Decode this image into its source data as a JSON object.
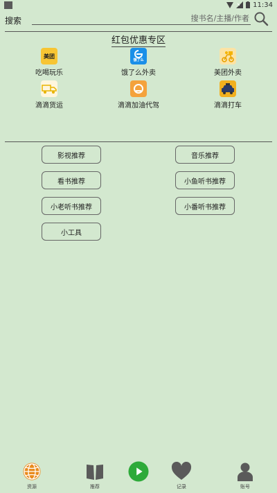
{
  "status": {
    "time": "11:34"
  },
  "search": {
    "label": "搜索",
    "placeholder": "搜书名/主播/作者"
  },
  "promo": {
    "title": "红包优惠专区",
    "items": [
      {
        "label": "吃喝玩乐",
        "logo_text": "美团",
        "icon": "meituan-logo-icon"
      },
      {
        "label": "饿了么外卖",
        "logo_text": "饿了么",
        "icon": "eleme-logo-icon"
      },
      {
        "label": "美团外卖",
        "logo_text": "",
        "icon": "meituan-waimai-logo-icon"
      },
      {
        "label": "滴滴货运",
        "logo_text": "",
        "icon": "didi-freight-logo-icon"
      },
      {
        "label": "滴滴加油代驾",
        "logo_text": "",
        "icon": "didi-logo-icon"
      },
      {
        "label": "滴滴打车",
        "logo_text": "",
        "icon": "didi-taxi-logo-icon"
      }
    ]
  },
  "recommend": {
    "buttons": [
      "影视推荐",
      "音乐推荐",
      "看书推荐",
      "小鱼听书推荐",
      "小老听书推荐",
      "小番听书推荐",
      "小工具"
    ]
  },
  "nav": {
    "items": [
      {
        "label": "资源",
        "icon": "globe-icon"
      },
      {
        "label": "推荐",
        "icon": "book-icon"
      },
      {
        "label": "",
        "icon": "play-icon"
      },
      {
        "label": "记录",
        "icon": "heart-icon"
      },
      {
        "label": "账号",
        "icon": "user-icon"
      }
    ]
  },
  "colors": {
    "background": "#d3e8cf",
    "play": "#2eaa3a",
    "globe": "#e98a1c",
    "nav_icon": "#5a5a5a"
  }
}
